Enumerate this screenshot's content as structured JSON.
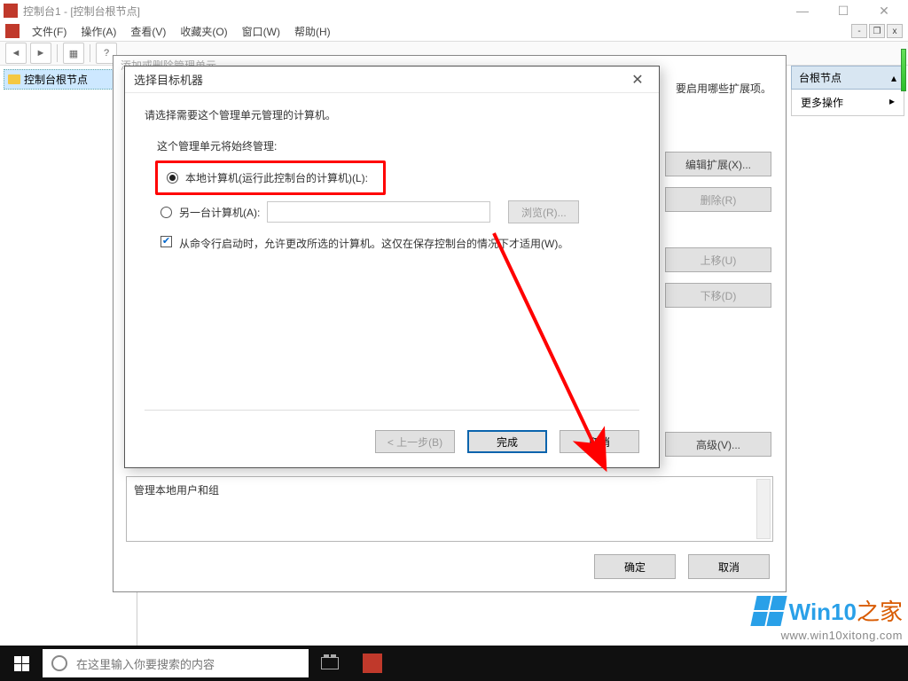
{
  "window": {
    "title": "控制台1 - [控制台根节点]"
  },
  "menus": {
    "file": "文件(F)",
    "action": "操作(A)",
    "view": "查看(V)",
    "favorites": "收藏夹(O)",
    "window": "窗口(W)",
    "help": "帮助(H)"
  },
  "tree": {
    "root": "控制台根节点"
  },
  "right_pane": {
    "header": "台根节点",
    "more": "更多操作"
  },
  "bg_dialog": {
    "title": "添加或删除管理单元",
    "hint": "要启用哪些扩展项。",
    "buttons": {
      "edit_ext": "编辑扩展(X)...",
      "delete": "删除(R)",
      "move_up": "上移(U)",
      "move_down": "下移(D)",
      "advanced": "高级(V)..."
    },
    "ok": "确定",
    "cancel": "取消",
    "desc": "管理本地用户和组"
  },
  "front_dialog": {
    "title": "选择目标机器",
    "prompt": "请选择需要这个管理单元管理的计算机。",
    "group": "这个管理单元将始终管理:",
    "radio_local": "本地计算机(运行此控制台的计算机)(L):",
    "radio_other": "另一台计算机(A):",
    "browse": "浏览(R)...",
    "chk_text": "从命令行启动时，允许更改所选的计算机。这仅在保存控制台的情况下才适用(W)。",
    "back": "< 上一步(B)",
    "finish": "完成",
    "cancel": "取消"
  },
  "taskbar": {
    "search_placeholder": "在这里输入你要搜索的内容"
  },
  "watermark": {
    "brand1": "Win10",
    "brand2": "之家",
    "url": "www.win10xitong.com"
  }
}
